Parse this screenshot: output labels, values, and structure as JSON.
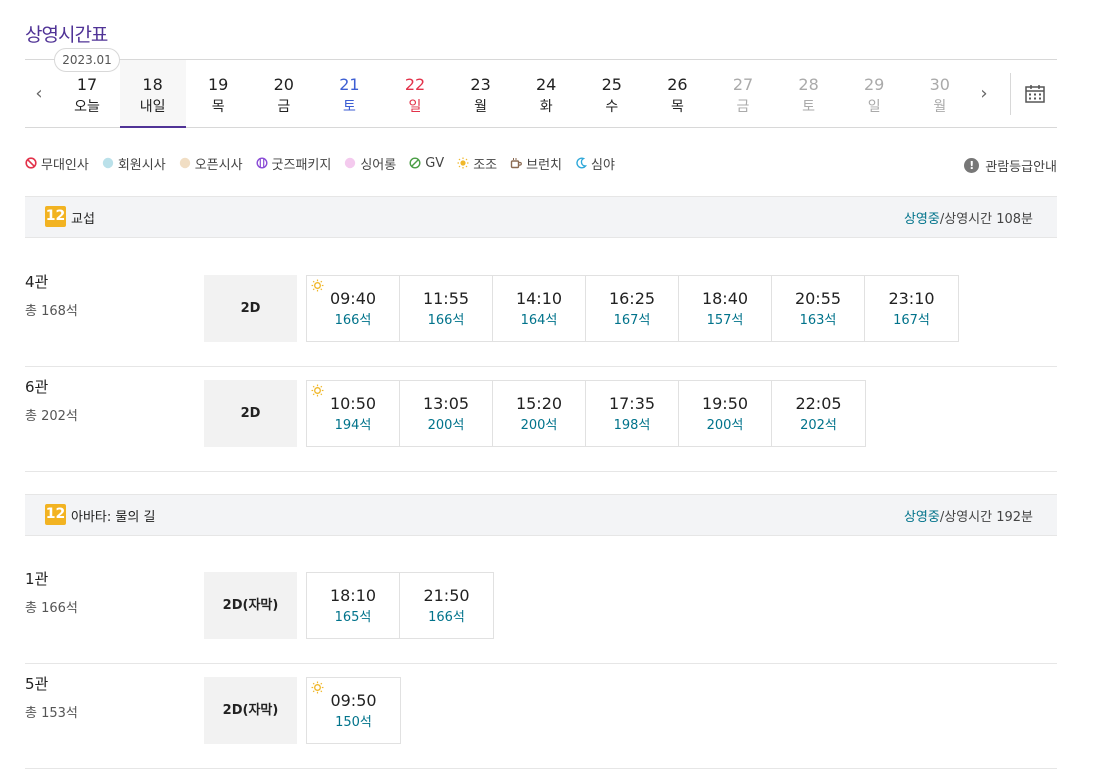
{
  "page_title": "상영시간표",
  "date_nav": {
    "month_badge": "2023.01",
    "days": [
      {
        "num": "17",
        "weekday": "오늘",
        "kind": "normal"
      },
      {
        "num": "18",
        "weekday": "내일",
        "kind": "active"
      },
      {
        "num": "19",
        "weekday": "목",
        "kind": "normal"
      },
      {
        "num": "20",
        "weekday": "금",
        "kind": "normal"
      },
      {
        "num": "21",
        "weekday": "토",
        "kind": "sat"
      },
      {
        "num": "22",
        "weekday": "일",
        "kind": "sun"
      },
      {
        "num": "23",
        "weekday": "월",
        "kind": "normal"
      },
      {
        "num": "24",
        "weekday": "화",
        "kind": "normal"
      },
      {
        "num": "25",
        "weekday": "수",
        "kind": "normal"
      },
      {
        "num": "26",
        "weekday": "목",
        "kind": "normal"
      },
      {
        "num": "27",
        "weekday": "금",
        "kind": "dis"
      },
      {
        "num": "28",
        "weekday": "토",
        "kind": "dis"
      },
      {
        "num": "29",
        "weekday": "일",
        "kind": "dis"
      },
      {
        "num": "30",
        "weekday": "월",
        "kind": "dis"
      }
    ]
  },
  "legend": [
    {
      "icon": "no-entry-icon",
      "label": "무대인사",
      "color": "#e2324a"
    },
    {
      "icon": "circle-icon",
      "label": "회원시사",
      "color": "#3eaac4"
    },
    {
      "icon": "circle-icon",
      "label": "오픈시사",
      "color": "#d9a35a"
    },
    {
      "icon": "stripes-icon",
      "label": "굿즈패키지",
      "color": "#8a4bd6"
    },
    {
      "icon": "circle-icon",
      "label": "싱어롱",
      "color": "#e06ad0"
    },
    {
      "icon": "slash-icon",
      "label": "GV",
      "color": "#4a9e45"
    },
    {
      "icon": "sun-icon",
      "label": "조조",
      "color": "#f0b72a"
    },
    {
      "icon": "cup-icon",
      "label": "브런치",
      "color": "#8a6a52"
    },
    {
      "icon": "moon-icon",
      "label": "심야",
      "color": "#2fa8d9"
    }
  ],
  "rating_guide": "관람등급안내",
  "movies": [
    {
      "age": "12",
      "title": "교섭",
      "status": "상영중",
      "runtime": "/상영시간 108분",
      "halls": [
        {
          "name": "4관",
          "seats": "총 168석",
          "format": "2D",
          "slots": [
            {
              "time": "09:40",
              "seats": "166석",
              "morning": true
            },
            {
              "time": "11:55",
              "seats": "166석"
            },
            {
              "time": "14:10",
              "seats": "164석"
            },
            {
              "time": "16:25",
              "seats": "167석"
            },
            {
              "time": "18:40",
              "seats": "157석"
            },
            {
              "time": "20:55",
              "seats": "163석"
            },
            {
              "time": "23:10",
              "seats": "167석"
            }
          ]
        },
        {
          "name": "6관",
          "seats": "총 202석",
          "format": "2D",
          "slots": [
            {
              "time": "10:50",
              "seats": "194석",
              "morning": true
            },
            {
              "time": "13:05",
              "seats": "200석"
            },
            {
              "time": "15:20",
              "seats": "200석"
            },
            {
              "time": "17:35",
              "seats": "198석"
            },
            {
              "time": "19:50",
              "seats": "200석"
            },
            {
              "time": "22:05",
              "seats": "202석"
            }
          ]
        }
      ]
    },
    {
      "age": "12",
      "title": "아바타: 물의 길",
      "status": "상영중",
      "runtime": "/상영시간 192분",
      "halls": [
        {
          "name": "1관",
          "seats": "총 166석",
          "format": "2D(자막)",
          "slots": [
            {
              "time": "18:10",
              "seats": "165석"
            },
            {
              "time": "21:50",
              "seats": "166석"
            }
          ]
        },
        {
          "name": "5관",
          "seats": "총 153석",
          "format": "2D(자막)",
          "slots": [
            {
              "time": "09:50",
              "seats": "150석",
              "morning": true
            }
          ]
        }
      ]
    }
  ]
}
